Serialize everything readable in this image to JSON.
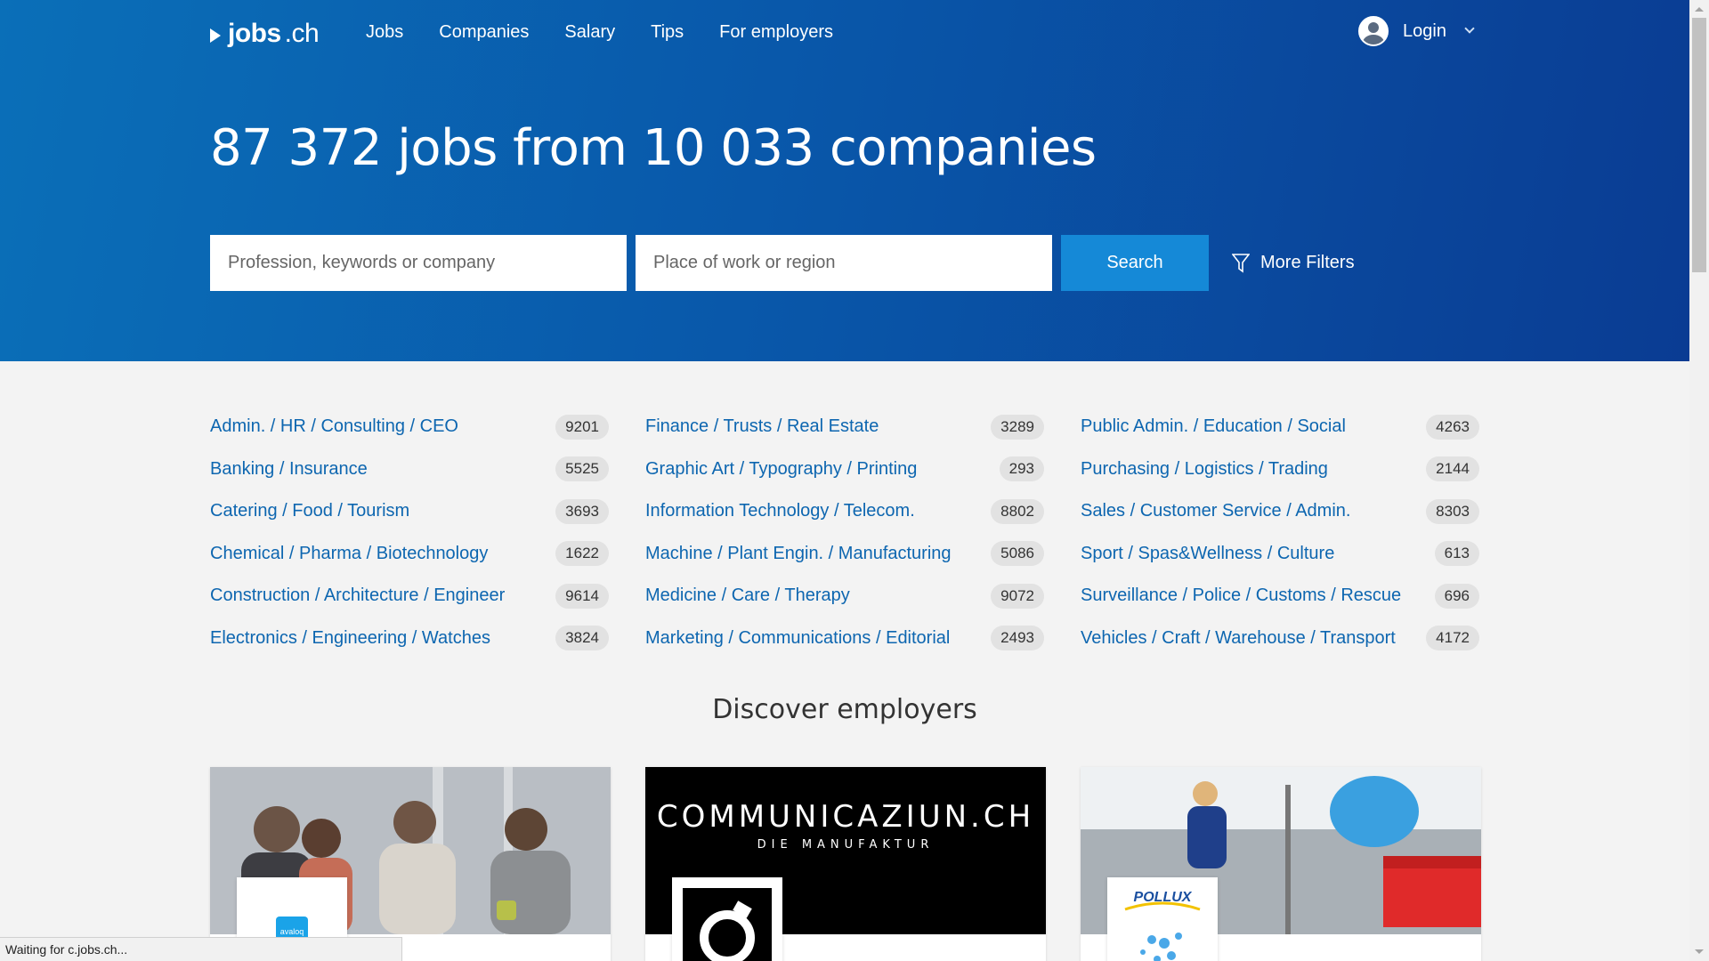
{
  "logo": {
    "brand": "jobs",
    "tld": ".ch"
  },
  "nav": [
    "Jobs",
    "Companies",
    "Salary",
    "Tips",
    "For employers"
  ],
  "login_label": "Login",
  "headline": "87 372 jobs from 10 033 companies",
  "search": {
    "keyword_placeholder": "Profession, keywords or company",
    "location_placeholder": "Place of work or region",
    "button_label": "Search",
    "more_filters_label": "More Filters"
  },
  "categories": {
    "col1": [
      {
        "name": "Admin. / HR / Consulting / CEO",
        "count": "9201"
      },
      {
        "name": "Banking / Insurance",
        "count": "5525"
      },
      {
        "name": "Catering / Food / Tourism",
        "count": "3693"
      },
      {
        "name": "Chemical / Pharma / Biotechnology",
        "count": "1622"
      },
      {
        "name": "Construction / Architecture / Engineer",
        "count": "9614"
      },
      {
        "name": "Electronics / Engineering / Watches",
        "count": "3824"
      }
    ],
    "col2": [
      {
        "name": "Finance / Trusts / Real Estate",
        "count": "3289"
      },
      {
        "name": "Graphic Art / Typography / Printing",
        "count": "293"
      },
      {
        "name": "Information Technology / Telecom.",
        "count": "8802"
      },
      {
        "name": "Machine / Plant Engin. / Manufacturing",
        "count": "5086"
      },
      {
        "name": "Medicine / Care / Therapy",
        "count": "9072"
      },
      {
        "name": "Marketing / Communications / Editorial",
        "count": "2493"
      }
    ],
    "col3": [
      {
        "name": "Public Admin. / Education / Social",
        "count": "4263"
      },
      {
        "name": "Purchasing / Logistics / Trading",
        "count": "2144"
      },
      {
        "name": "Sales / Customer Service / Admin.",
        "count": "8303"
      },
      {
        "name": "Sport / Spas&Wellness / Culture",
        "count": "613"
      },
      {
        "name": "Surveillance / Police / Customs / Rescue",
        "count": "696"
      },
      {
        "name": "Vehicles / Craft / Warehouse / Transport",
        "count": "4172"
      }
    ]
  },
  "discover_title": "Discover employers",
  "employers": {
    "card1_logo": "avaloq",
    "card2_title": "COMMUNICAZIUN.CH",
    "card2_sub": "DIE MANUFAKTUR",
    "card3_logo": "POLLUX"
  },
  "status_text": "Waiting for c.jobs.ch...",
  "colors": {
    "hero_start": "#0a6fb8",
    "hero_end": "#0a3c93",
    "link": "#0d66b0",
    "button": "#1589d7"
  }
}
